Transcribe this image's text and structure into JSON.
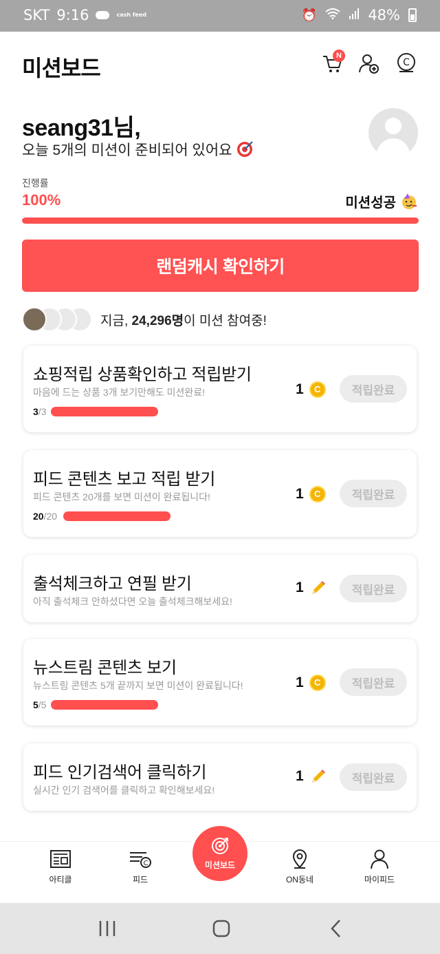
{
  "status_bar": {
    "carrier": "SKT",
    "time": "9:16",
    "battery": "48%",
    "cashfeed_badge": "cash feed"
  },
  "header": {
    "title": "미션보드",
    "cart_badge": "N",
    "icons": [
      "cart-icon",
      "add-friend-icon",
      "cash-icon"
    ]
  },
  "greeting": {
    "name": "seang31님,",
    "subtitle": "오늘 5개의 미션이 준비되어 있어요"
  },
  "progress": {
    "label": "진행률",
    "percent_text": "100%",
    "value": 1.0,
    "status_text": "미션성공"
  },
  "cta": {
    "label": "랜덤캐시 확인하기"
  },
  "participants": {
    "prefix": "지금, ",
    "count": "24,296명",
    "suffix": "이 미션 참여중!"
  },
  "missions": [
    {
      "title": "쇼핑적립 상품확인하고 적립받기",
      "desc": "마음에 드는 상품 3개 보기만해도 미션완료!",
      "done": "3",
      "total": "/3",
      "reward": "1",
      "reward_icon": "coin-icon",
      "button": "적립완료"
    },
    {
      "title": "피드 콘텐츠 보고 적립 받기",
      "desc": "피드 콘텐츠 20개를 보면 미션이 완료됩니다!",
      "done": "20",
      "total": "/20",
      "reward": "1",
      "reward_icon": "coin-icon",
      "button": "적립완료"
    },
    {
      "title": "출석체크하고 연필 받기",
      "desc": "아직 출석체크 안하셨다면 오늘 출석체크해보세요!",
      "reward": "1",
      "reward_icon": "pencil-icon",
      "button": "적립완료"
    },
    {
      "title": "뉴스트림 콘텐츠 보기",
      "desc": "뉴스트림 콘텐츠 5개 끝까지 보면 미션이 완료됩니다!",
      "done": "5",
      "total": "/5",
      "reward": "1",
      "reward_icon": "coin-icon",
      "button": "적립완료"
    },
    {
      "title": "피드 인기검색어 클릭하기",
      "desc": "실시간 인기 검색어를 클릭하고 확인해보세요!",
      "reward": "1",
      "reward_icon": "pencil-icon",
      "button": "적립완료"
    }
  ],
  "bottom_nav": {
    "article": "아티클",
    "feed": "피드",
    "missionboard": "미션보드",
    "on_neighborhood": "ON동네",
    "myfeed": "마이피드"
  },
  "colors": {
    "accent": "#ff4f4f",
    "coin": "#f4b400",
    "disabled_bg": "#ececec",
    "disabled_text": "#bdbdbd"
  }
}
